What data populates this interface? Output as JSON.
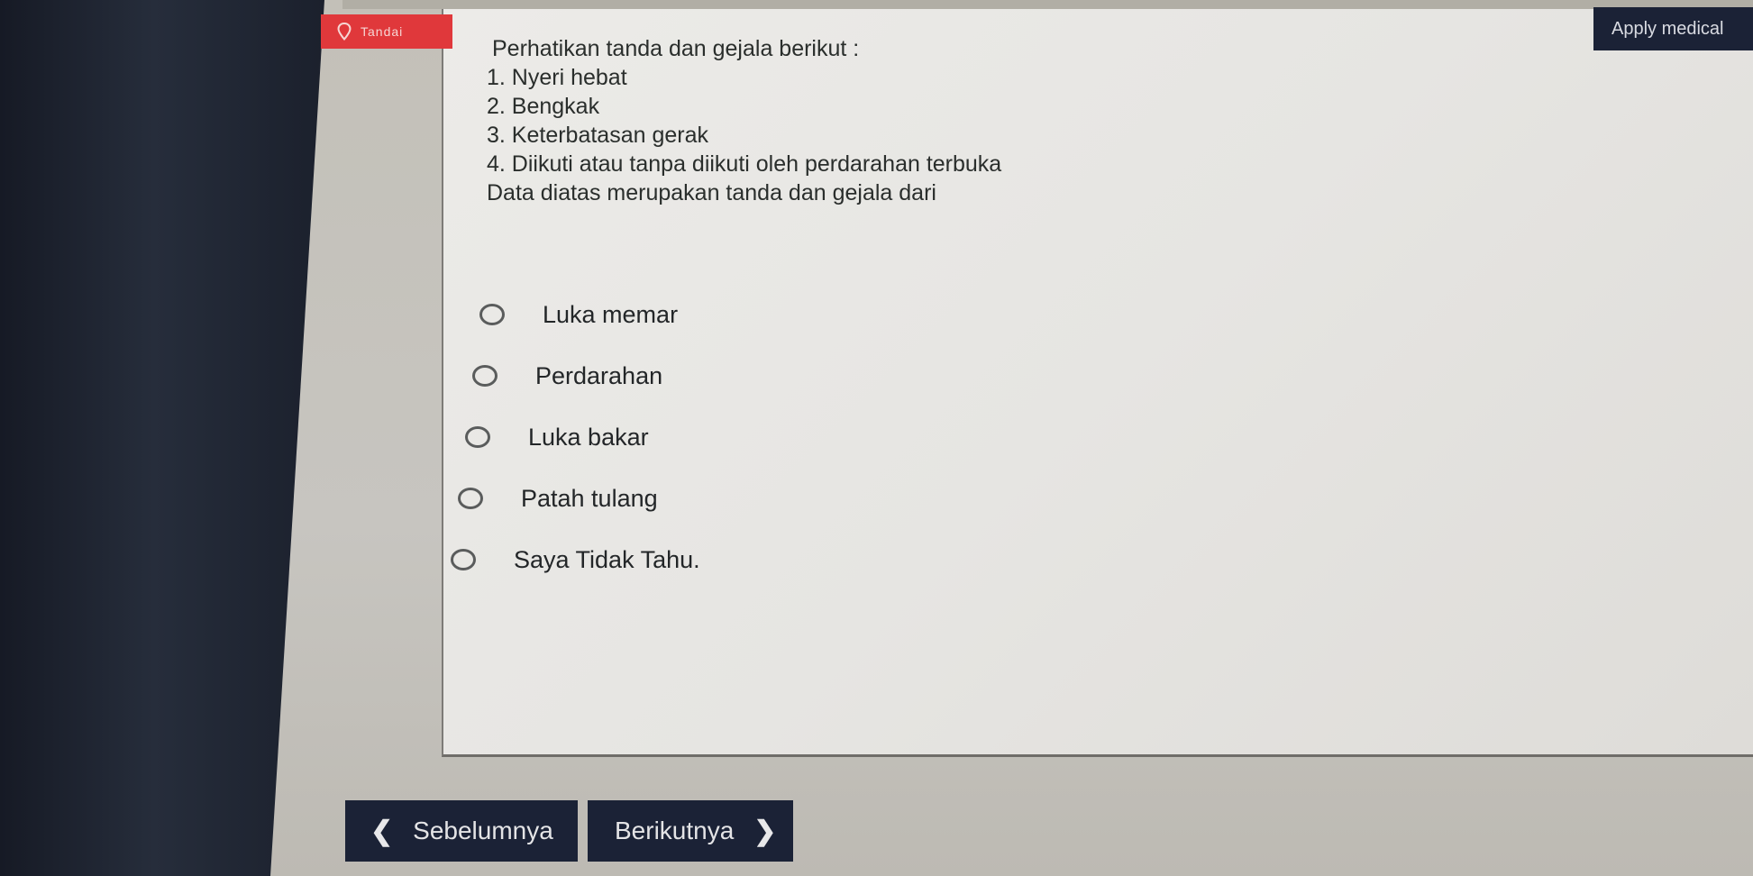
{
  "header": {
    "flag_button_label": "Tandai",
    "flag_icon": "map-pin-icon",
    "apply_button_label": "Apply medical"
  },
  "question": {
    "intro": "Perhatikan tanda dan gejala berikut :",
    "items": [
      "1. Nyeri hebat",
      "2. Bengkak",
      "3. Keterbatasan gerak",
      "4. Diikuti atau tanpa diikuti oleh perdarahan terbuka"
    ],
    "closing": "Data diatas merupakan tanda dan gejala dari"
  },
  "options": [
    {
      "label": "Luka memar",
      "selected": false
    },
    {
      "label": "Perdarahan",
      "selected": false
    },
    {
      "label": "Luka bakar",
      "selected": false
    },
    {
      "label": "Patah tulang",
      "selected": false
    },
    {
      "label": "Saya Tidak Tahu.",
      "selected": false
    }
  ],
  "navigation": {
    "prev_label": "Sebelumnya",
    "prev_icon": "chevron-left-icon",
    "next_label": "Berikutnya",
    "next_icon": "chevron-right-icon"
  },
  "colors": {
    "flag_button": "#e0383b",
    "nav_button": "#1b2236",
    "panel_background": "#e8e7e4",
    "text": "#2a2e2c"
  }
}
